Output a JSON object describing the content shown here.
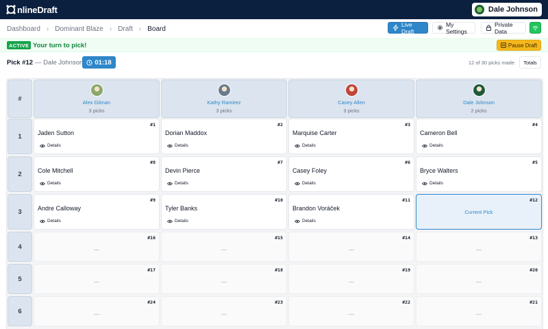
{
  "header": {
    "brand": "nlineDraft",
    "user_name": "Dale Johnson"
  },
  "breadcrumb": [
    "Dashboard",
    "Dominant Blaze",
    "Draft",
    "Board"
  ],
  "toolbar": {
    "live_draft": "Live Draft",
    "my_settings": "My Settings",
    "private_data": "Private Data"
  },
  "banner": {
    "status": "ACTIVE",
    "message": "Your turn to pick!",
    "pause_label": "Pause Draft"
  },
  "pick_info": {
    "pick_label": "Pick #12",
    "separator_user": "— Dale Johnson",
    "timer": "01:18",
    "progress": "12 of 30 picks made",
    "totals_label": "Totals"
  },
  "board": {
    "corner_label": "#",
    "details_label": "Details",
    "current_label": "Current Pick",
    "empty_label": "—",
    "teams": [
      {
        "name": "Alex Gilman",
        "picks": "3 picks",
        "avatar_color": "#8aa86b"
      },
      {
        "name": "Kathy Ramirez",
        "picks": "3 picks",
        "avatar_color": "#6b7b8c"
      },
      {
        "name": "Casey Allen",
        "picks": "3 picks",
        "avatar_color": "#c0463a"
      },
      {
        "name": "Dale Johnson",
        "picks": "2 picks",
        "avatar_color": "#1f5a3a"
      }
    ],
    "rounds": [
      {
        "round": "1",
        "cells": [
          {
            "no": "#1",
            "player": "Jaden Sutton"
          },
          {
            "no": "#2",
            "player": "Dorian Maddox"
          },
          {
            "no": "#3",
            "player": "Marquise Carter"
          },
          {
            "no": "#4",
            "player": "Cameron Bell"
          }
        ]
      },
      {
        "round": "2",
        "cells": [
          {
            "no": "#8",
            "player": "Cole Mitchell"
          },
          {
            "no": "#7",
            "player": "Devin Pierce"
          },
          {
            "no": "#6",
            "player": "Casey Foley"
          },
          {
            "no": "#5",
            "player": "Bryce Walters"
          }
        ]
      },
      {
        "round": "3",
        "cells": [
          {
            "no": "#9",
            "player": "Andre Calloway"
          },
          {
            "no": "#10",
            "player": "Tyler Banks"
          },
          {
            "no": "#11",
            "player": "Brandon Voráček"
          },
          {
            "no": "#12",
            "player": "",
            "current": true
          }
        ]
      },
      {
        "round": "4",
        "cells": [
          {
            "no": "#16",
            "player": ""
          },
          {
            "no": "#15",
            "player": ""
          },
          {
            "no": "#14",
            "player": ""
          },
          {
            "no": "#13",
            "player": ""
          }
        ]
      },
      {
        "round": "5",
        "cells": [
          {
            "no": "#17",
            "player": ""
          },
          {
            "no": "#18",
            "player": ""
          },
          {
            "no": "#19",
            "player": ""
          },
          {
            "no": "#20",
            "player": ""
          }
        ]
      },
      {
        "round": "6",
        "cells": [
          {
            "no": "#24",
            "player": ""
          },
          {
            "no": "#23",
            "player": ""
          },
          {
            "no": "#22",
            "player": ""
          },
          {
            "no": "#21",
            "player": ""
          }
        ]
      }
    ]
  },
  "colors": {
    "topbar": "#0b1f3f",
    "accent": "#2f86c9",
    "active_green": "#16a34a",
    "pause_yellow": "#f5b81c"
  }
}
